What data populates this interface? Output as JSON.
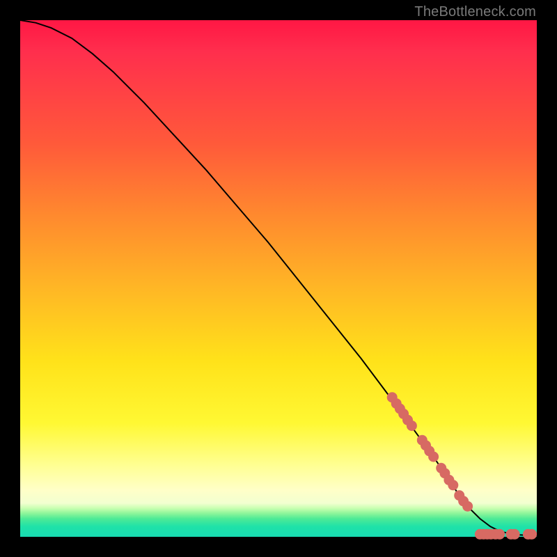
{
  "watermark": "TheBottleneck.com",
  "colors": {
    "frame": "#000000",
    "curve": "#000000",
    "dot": "#d76a63"
  },
  "chart_data": {
    "type": "line",
    "title": "",
    "xlabel": "",
    "ylabel": "",
    "xlim": [
      0,
      100
    ],
    "ylim": [
      0,
      100
    ],
    "grid": false,
    "legend": false,
    "series": [
      {
        "name": "curve",
        "x": [
          0,
          3,
          6,
          10,
          14,
          18,
          24,
          30,
          36,
          42,
          48,
          54,
          60,
          66,
          72,
          76,
          80,
          83,
          85,
          87,
          89,
          91,
          93,
          96,
          100
        ],
        "y": [
          100,
          99.5,
          98.5,
          96.5,
          93.5,
          90,
          84,
          77.5,
          71,
          64,
          57,
          49.5,
          42,
          34.5,
          26.5,
          21,
          15.5,
          11,
          8,
          5.5,
          3.5,
          2,
          1,
          0.4,
          0.2
        ]
      }
    ],
    "scatter": [
      {
        "name": "highlight-points",
        "points": [
          {
            "x": 72.0,
            "y": 27.0
          },
          {
            "x": 72.8,
            "y": 25.8
          },
          {
            "x": 73.5,
            "y": 24.8
          },
          {
            "x": 74.2,
            "y": 23.8
          },
          {
            "x": 75.0,
            "y": 22.6
          },
          {
            "x": 75.8,
            "y": 21.5
          },
          {
            "x": 77.8,
            "y": 18.7
          },
          {
            "x": 78.5,
            "y": 17.7
          },
          {
            "x": 79.2,
            "y": 16.6
          },
          {
            "x": 80.0,
            "y": 15.5
          },
          {
            "x": 81.5,
            "y": 13.3
          },
          {
            "x": 82.2,
            "y": 12.3
          },
          {
            "x": 83.0,
            "y": 11.0
          },
          {
            "x": 83.8,
            "y": 10.0
          },
          {
            "x": 85.0,
            "y": 8.0
          },
          {
            "x": 85.8,
            "y": 6.9
          },
          {
            "x": 86.6,
            "y": 5.9
          },
          {
            "x": 89.0,
            "y": 0.5
          },
          {
            "x": 89.7,
            "y": 0.5
          },
          {
            "x": 90.4,
            "y": 0.5
          },
          {
            "x": 91.1,
            "y": 0.5
          },
          {
            "x": 92.0,
            "y": 0.5
          },
          {
            "x": 92.8,
            "y": 0.5
          },
          {
            "x": 95.0,
            "y": 0.5
          },
          {
            "x": 95.7,
            "y": 0.5
          },
          {
            "x": 98.3,
            "y": 0.5
          },
          {
            "x": 99.0,
            "y": 0.5
          }
        ]
      }
    ]
  }
}
